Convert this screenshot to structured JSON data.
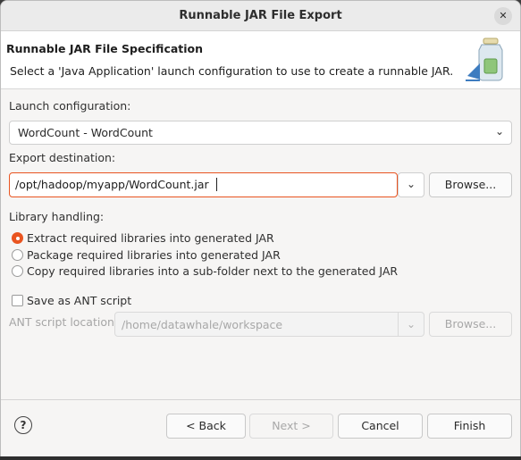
{
  "window": {
    "title": "Runnable JAR File Export",
    "close_glyph": "✕"
  },
  "banner": {
    "title": "Runnable JAR File Specification",
    "description": "Select a 'Java Application' launch configuration to use to create a runnable JAR.",
    "icon": "jar-export-wizard-icon"
  },
  "launch": {
    "label": "Launch configuration:",
    "selected": "WordCount - WordCount",
    "chevron": "⌄"
  },
  "export": {
    "label": "Export destination:",
    "value": "/opt/hadoop/myapp/WordCount.jar",
    "dropdown_glyph": "⌄",
    "browse_label": "Browse..."
  },
  "library": {
    "label": "Library handling:",
    "options": [
      {
        "label": "Extract required libraries into generated JAR",
        "selected": true
      },
      {
        "label": "Package required libraries into generated JAR",
        "selected": false
      },
      {
        "label": "Copy required libraries into a sub-folder next to the generated JAR",
        "selected": false
      }
    ]
  },
  "ant": {
    "checkbox_label": "Save as ANT script",
    "checked": false,
    "location_label": "ANT script location:",
    "location_value": "/home/datawhale/workspace",
    "dropdown_glyph": "⌄",
    "browse_label": "Browse..."
  },
  "footer": {
    "help_glyph": "?",
    "back_label": "< Back",
    "next_label": "Next >",
    "cancel_label": "Cancel",
    "finish_label": "Finish"
  },
  "colors": {
    "accent": "#e95420",
    "text": "#303030",
    "disabled": "#a8a8a8"
  }
}
